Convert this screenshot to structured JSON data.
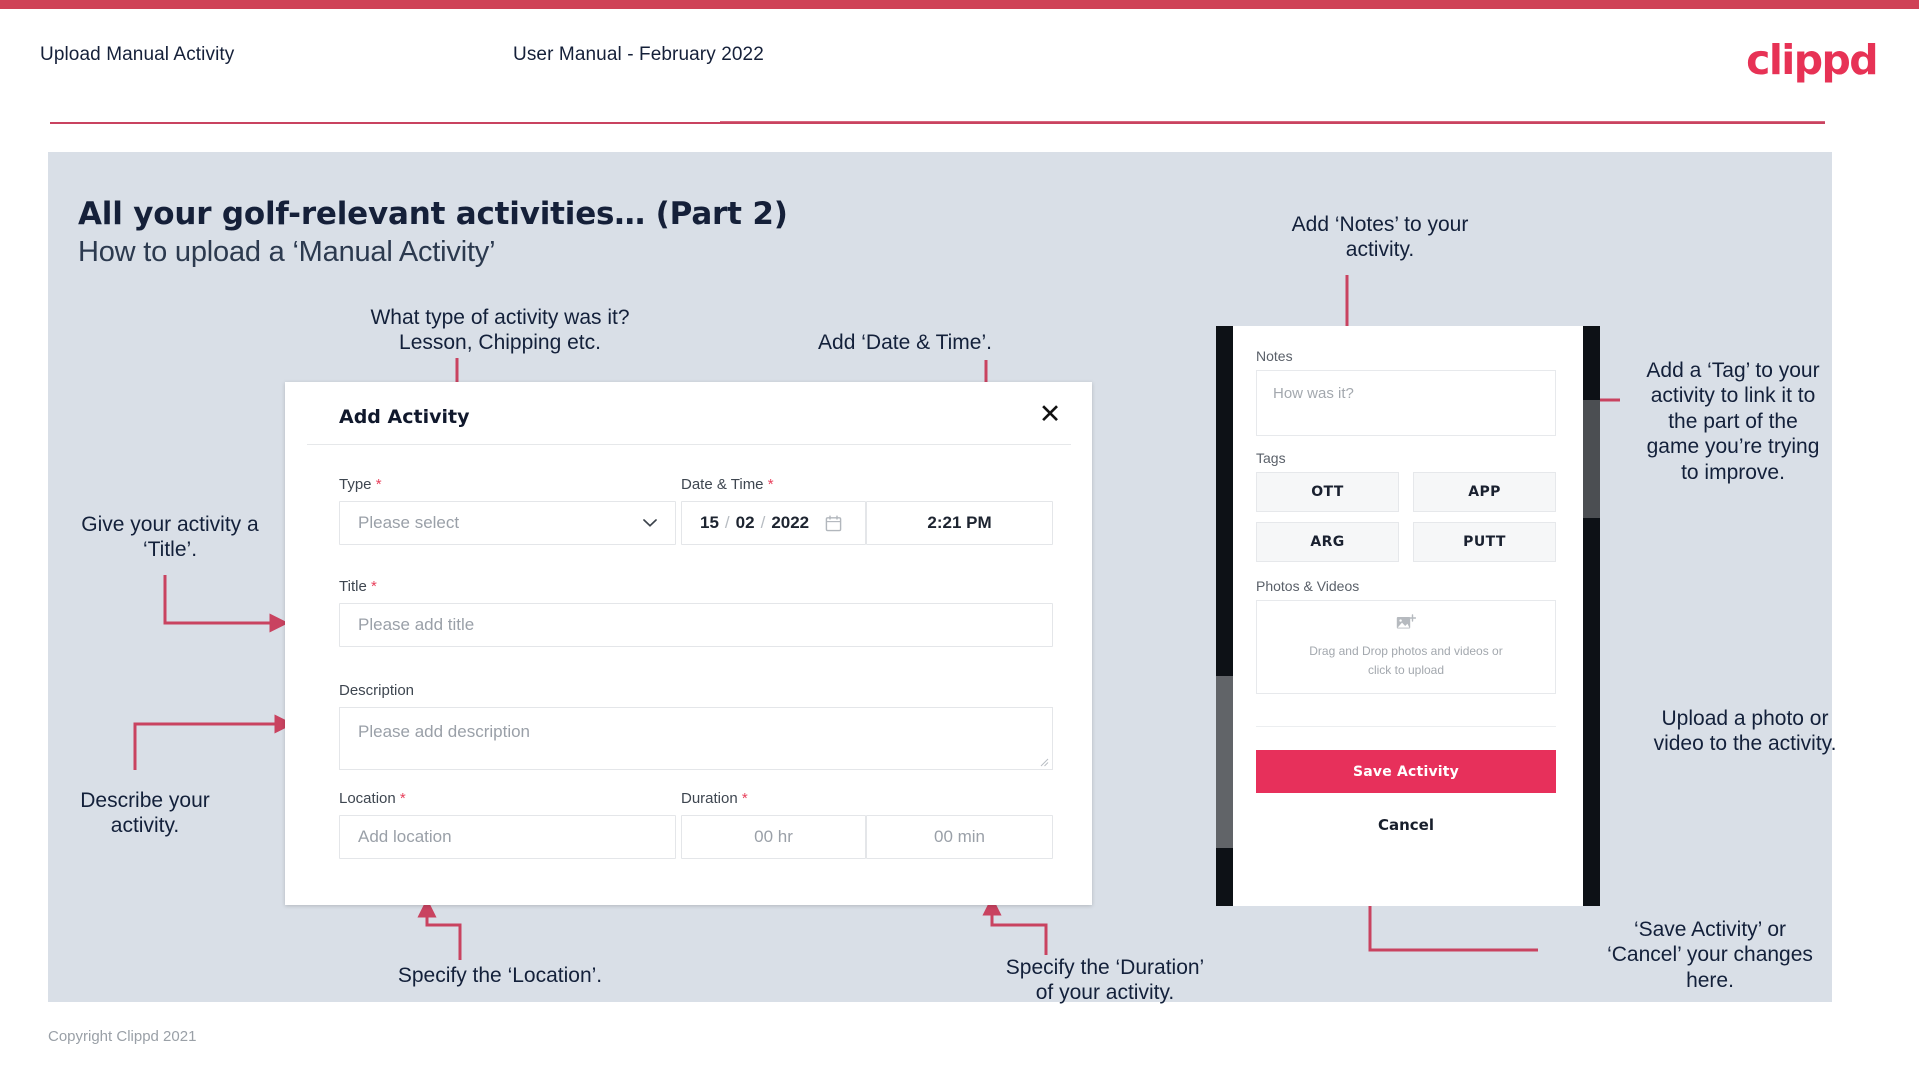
{
  "theme": {
    "accent": "#cf4257",
    "brand_pink": "#e73255",
    "save_button": "#e7305b",
    "slide_bg": "#d9dfe7",
    "text_dark": "#152039",
    "arrow": "#c94360"
  },
  "header": {
    "title": "Upload Manual Activity",
    "subtitle": "User Manual - February 2022",
    "logo": "clippd"
  },
  "slide": {
    "title": "All your golf-relevant activities… (Part 2)",
    "subtitle": "How to upload a ‘Manual Activity’"
  },
  "annotations": {
    "type": "What type of activity was it?\nLesson, Chipping etc.",
    "datetime": "Add ‘Date & Time’.",
    "title": "Give your activity a\n‘Title’.",
    "describe": "Describe your\nactivity.",
    "location": "Specify the ‘Location’.",
    "duration": "Specify the ‘Duration’\nof your activity.",
    "notes": "Add ‘Notes’ to your\nactivity.",
    "tag": "Add a ‘Tag’ to your\nactivity to link it to\nthe part of the\ngame you’re trying\nto improve.",
    "upload": "Upload a photo or\nvideo to the activity.",
    "save": "‘Save Activity’ or\n‘Cancel’ your changes\nhere."
  },
  "modal": {
    "title": "Add Activity",
    "close_icon": "close-icon",
    "fields": {
      "type": {
        "label": "Type",
        "required": "*",
        "placeholder": "Please select",
        "icon": "chevron-down-icon"
      },
      "datetime": {
        "label": "Date & Time",
        "required": "*",
        "day": "15",
        "month": "02",
        "year": "2022",
        "sep": "/",
        "icon": "calendar-icon",
        "time": "2:21 PM"
      },
      "title": {
        "label": "Title",
        "required": "*",
        "placeholder": "Please add title"
      },
      "description": {
        "label": "Description",
        "required": "",
        "placeholder": "Please add description"
      },
      "location": {
        "label": "Location",
        "required": "*",
        "placeholder": "Add location"
      },
      "duration": {
        "label": "Duration",
        "required": "*",
        "hours_placeholder": "00 hr",
        "minutes_placeholder": "00 min"
      }
    }
  },
  "phone": {
    "notes": {
      "label": "Notes",
      "placeholder": "How was it?"
    },
    "tags": {
      "label": "Tags",
      "items": [
        "OTT",
        "APP",
        "ARG",
        "PUTT"
      ]
    },
    "photos": {
      "label": "Photos & Videos",
      "icon": "add-image-icon",
      "drop_text_line1": "Drag and Drop photos and videos or",
      "drop_text_line2": "click to upload"
    },
    "save_label": "Save Activity",
    "cancel_label": "Cancel"
  },
  "footer": {
    "copyright": "Copyright Clippd 2021"
  }
}
